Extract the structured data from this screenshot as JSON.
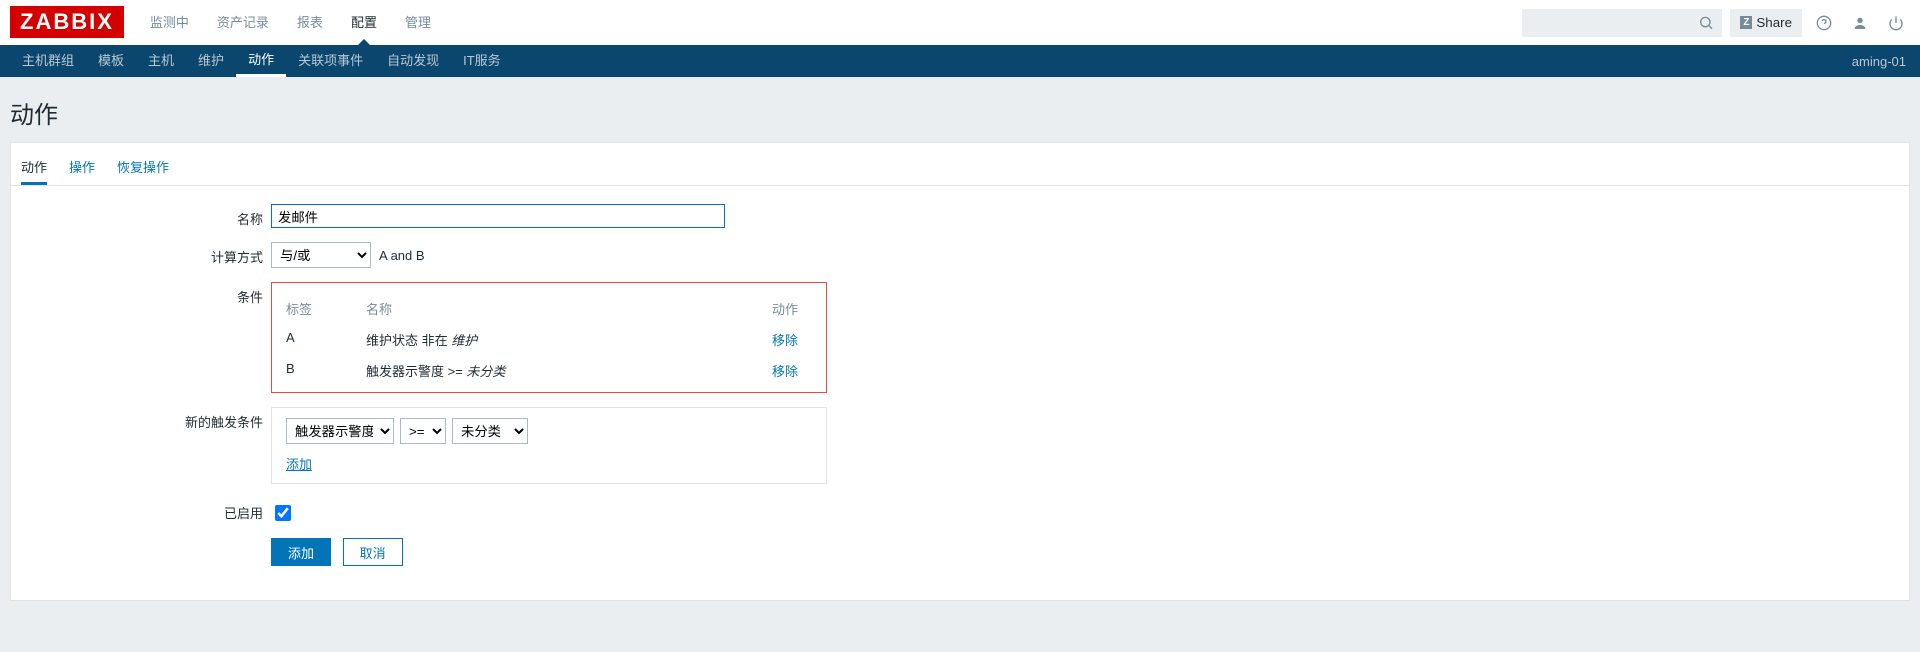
{
  "brand": "ZABBIX",
  "topmenu": [
    "监测中",
    "资产记录",
    "报表",
    "配置",
    "管理"
  ],
  "topmenu_active_index": 3,
  "share_label": "Share",
  "search_placeholder": "",
  "submenu": [
    "主机群组",
    "模板",
    "主机",
    "维护",
    "动作",
    "关联项事件",
    "自动发现",
    "IT服务"
  ],
  "submenu_active_index": 4,
  "host_label": "aming-01",
  "page_title": "动作",
  "tabs": [
    "动作",
    "操作",
    "恢复操作"
  ],
  "tab_active_index": 0,
  "form": {
    "name_label": "名称",
    "name_value": "发邮件",
    "calc_label": "计算方式",
    "calc_select": "与/或",
    "calc_text": "A and B",
    "cond_label": "条件",
    "cond_headers": {
      "label": "标签",
      "name": "名称",
      "action": "动作"
    },
    "cond_rows": [
      {
        "label": "A",
        "name_prefix": "维护状态 非在 ",
        "name_italic": "维护",
        "action": "移除"
      },
      {
        "label": "B",
        "name_prefix": "触发器示警度 >= ",
        "name_italic": "未分类",
        "action": "移除"
      }
    ],
    "newcond_label": "新的触发条件",
    "newcond_select1": "触发器示警度",
    "newcond_select2": ">=",
    "newcond_select3": "未分类",
    "newcond_add": "添加",
    "enabled_label": "已启用",
    "enabled_checked": true,
    "submit_add": "添加",
    "submit_cancel": "取消"
  }
}
